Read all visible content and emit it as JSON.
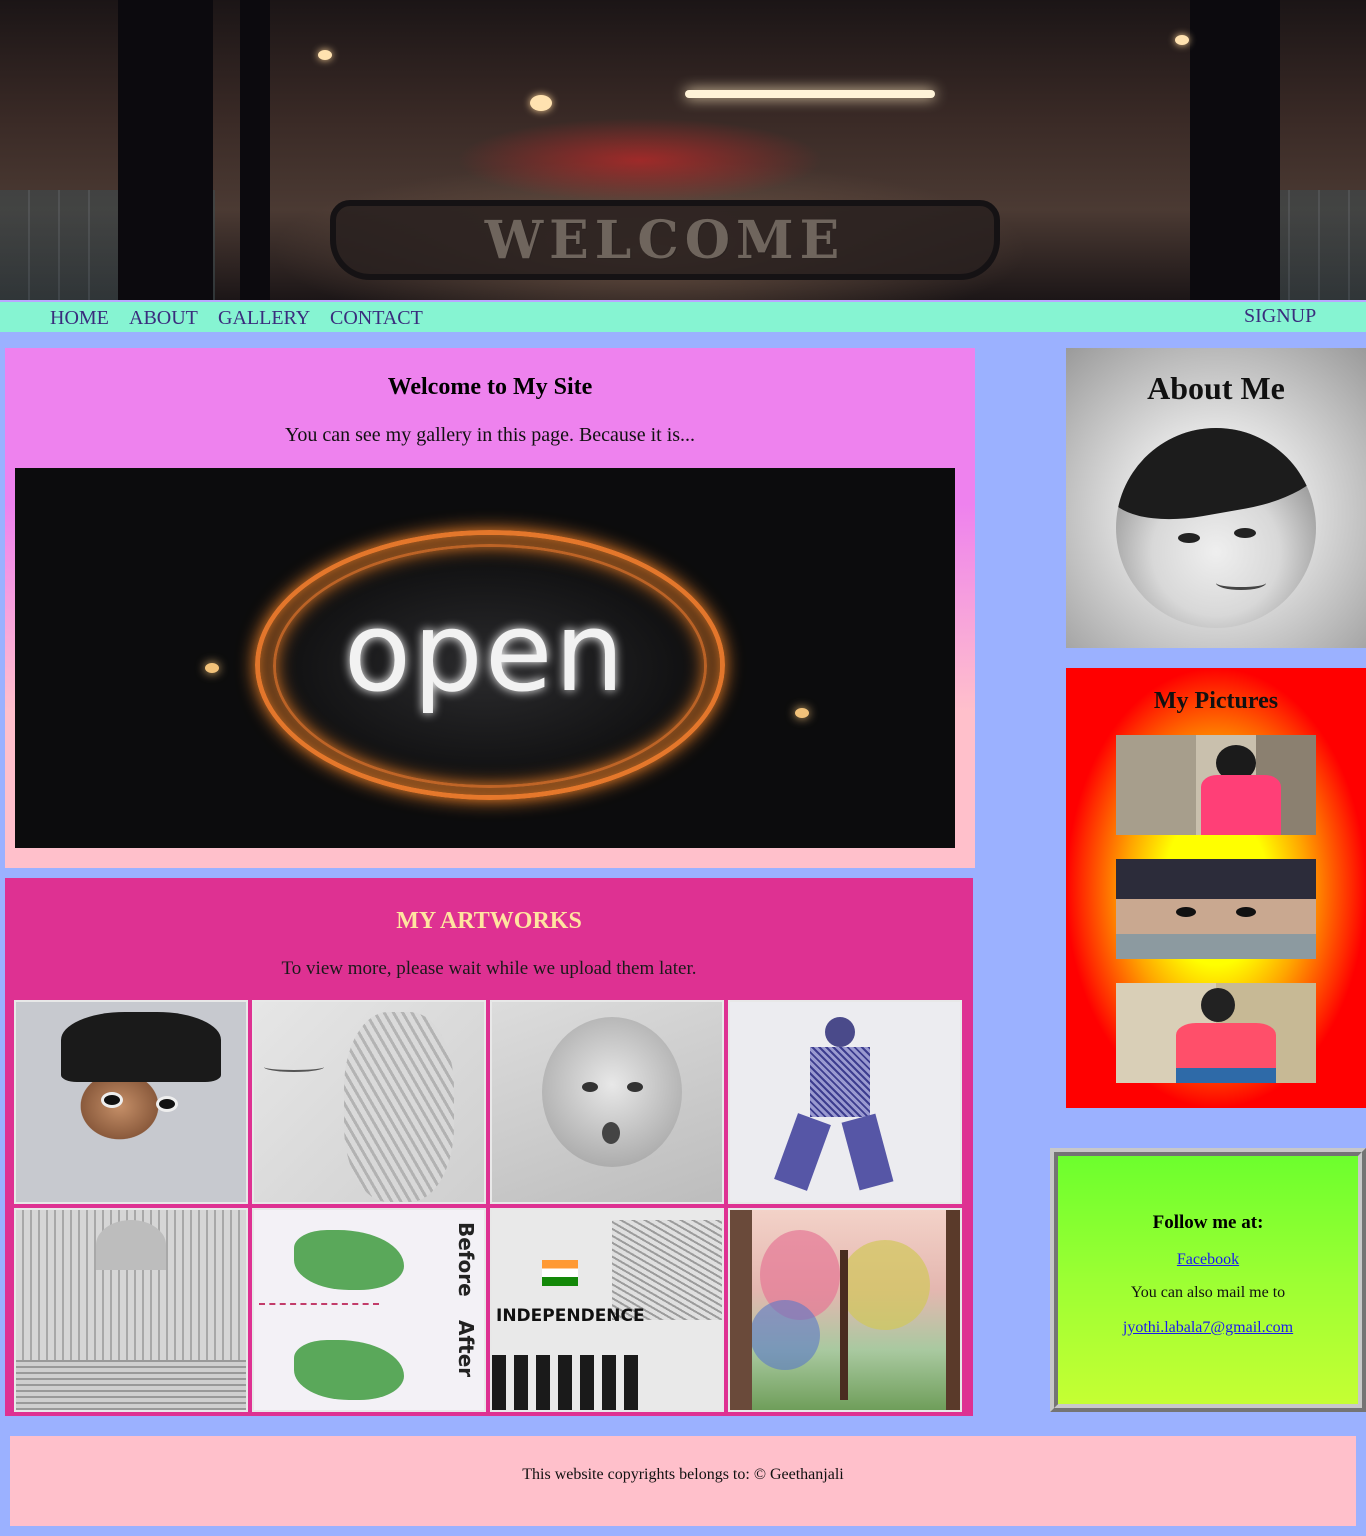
{
  "banner": {
    "sign_text": "WELCOME"
  },
  "nav": {
    "items": [
      {
        "label": "HOME"
      },
      {
        "label": "ABOUT"
      },
      {
        "label": "GALLERY"
      },
      {
        "label": "CONTACT"
      }
    ],
    "signup": "SIGNUP"
  },
  "welcome": {
    "title": "Welcome to My Site",
    "text": "You can see my gallery in this page. Because it is...",
    "image_text": "open"
  },
  "artworks": {
    "title": "MY ARTWORKS",
    "text": "To view more, please wait while we upload them later.",
    "captions": {
      "before": "Before",
      "after": "After",
      "independence": "INDEPENDENCE"
    }
  },
  "about": {
    "title": "About Me"
  },
  "pictures": {
    "title": "My Pictures"
  },
  "follow": {
    "title": "Follow me at:",
    "facebook": "Facebook",
    "mail_text": "You can also mail me to",
    "email": "jyothi.labala7@gmail.com"
  },
  "footer": {
    "text": "This website copyrights belongs to: © Geethanjali"
  },
  "colors": {
    "page_bg": "#9bb1ff",
    "nav_bg": "#86f4d2",
    "nav_text": "#3a2d7d",
    "art_panel_bg": "#de3192",
    "art_title": "#ffe4a0",
    "footer_bg": "#ffc0cb"
  }
}
